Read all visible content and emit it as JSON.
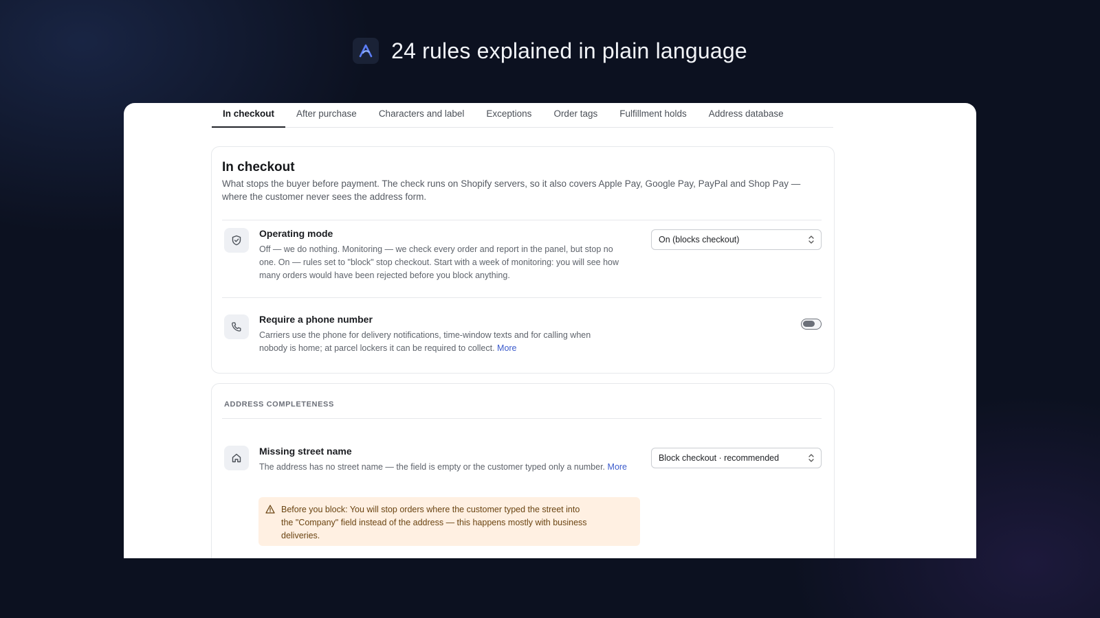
{
  "hero": {
    "title": "24 rules explained in plain language",
    "logo_icon": "brand-logo-icon"
  },
  "tabs": [
    {
      "label": "In checkout",
      "active": true
    },
    {
      "label": "After purchase",
      "active": false
    },
    {
      "label": "Characters and label",
      "active": false
    },
    {
      "label": "Exceptions",
      "active": false
    },
    {
      "label": "Order tags",
      "active": false
    },
    {
      "label": "Fulfillment holds",
      "active": false
    },
    {
      "label": "Address database",
      "active": false
    }
  ],
  "checkout_card": {
    "title": "In checkout",
    "description": "What stops the buyer before payment. The check runs on Shopify servers, so it also covers Apple Pay, Google Pay, PayPal and Shop Pay — where the customer never sees the address form.",
    "operating_mode": {
      "icon": "shield-check-icon",
      "title": "Operating mode",
      "description": "Off — we do nothing. Monitoring — we check every order and report in the panel, but stop no one. On — rules set to \"block\" stop checkout. Start with a week of monitoring: you will see how many orders would have been rejected before you block anything.",
      "select_value": "On (blocks checkout)"
    },
    "require_phone": {
      "icon": "phone-icon",
      "title": "Require a phone number",
      "description": "Carriers use the phone for delivery notifications, time-window texts and for calling when nobody is home; at parcel lockers it can be required to collect.",
      "more_link": "More",
      "toggle_on": false
    }
  },
  "completeness_card": {
    "section_label": "ADDRESS COMPLETENESS",
    "missing_street": {
      "icon": "home-icon",
      "title": "Missing street name",
      "description": "The address has no street name — the field is empty or the customer typed only a number.",
      "more_link": "More",
      "select_value": "Block checkout · recommended",
      "warning_icon": "warning-triangle-icon",
      "warning": "Before you block: You will stop orders where the customer typed the street into the \"Company\" field instead of the address — this happens mostly with business deliveries."
    }
  },
  "colors": {
    "background": "#0c1120",
    "accent_link": "#3b5bcc",
    "warning_bg": "#fff0e2"
  }
}
